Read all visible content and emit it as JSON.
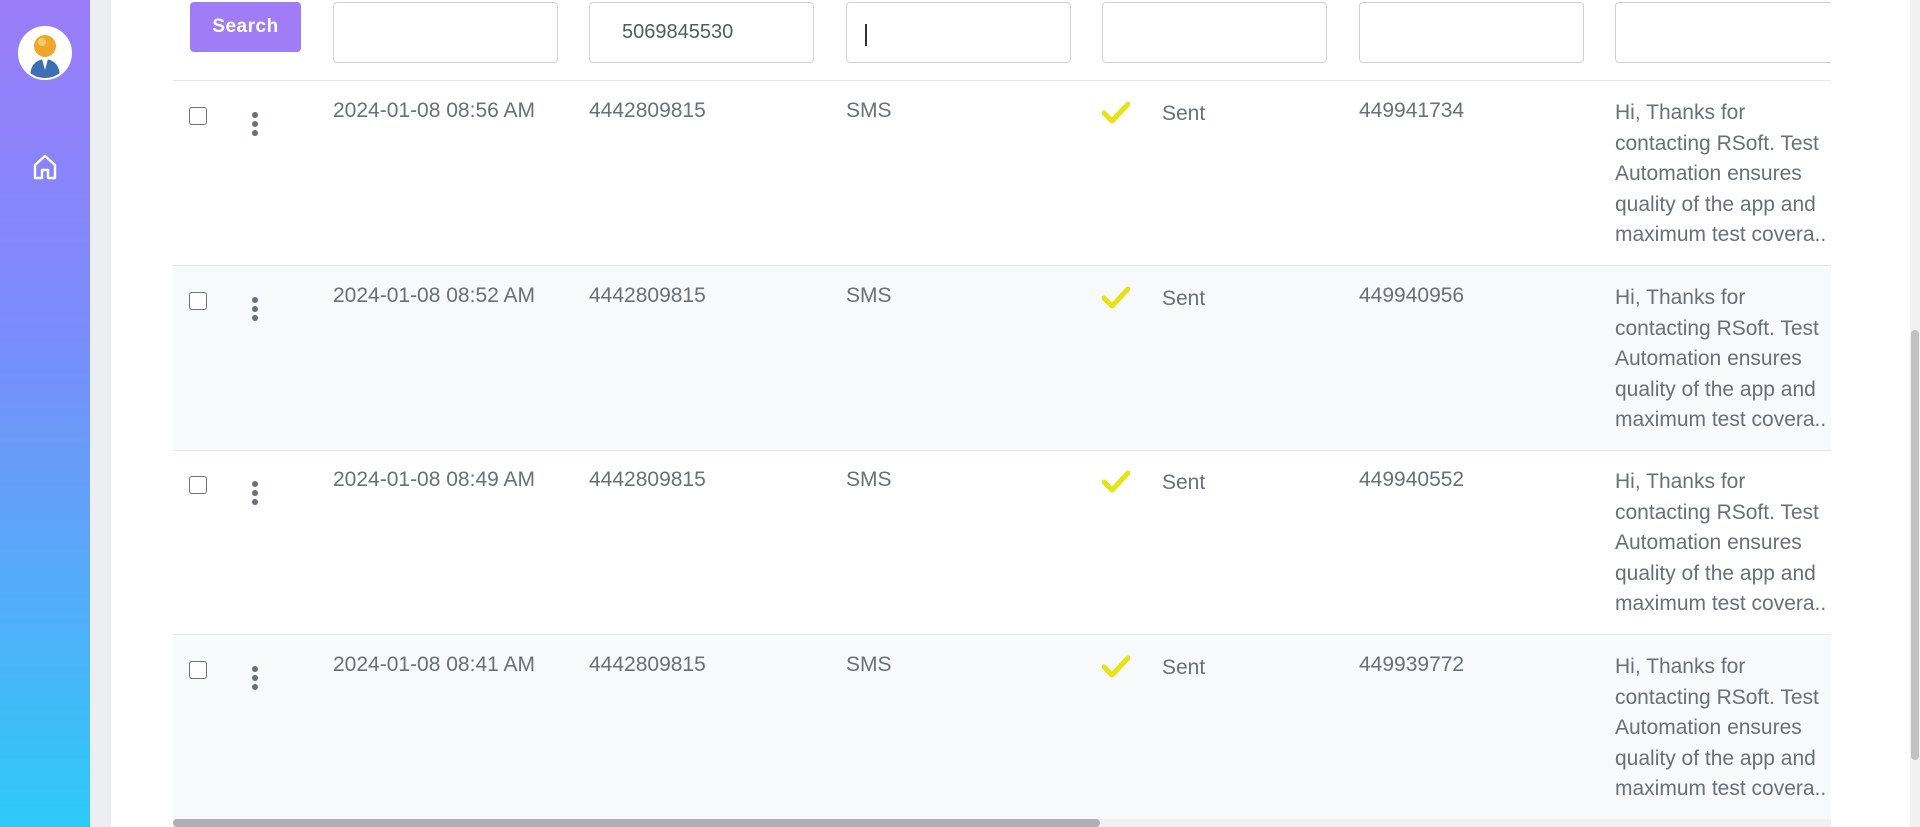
{
  "search": {
    "button_label": "Search"
  },
  "filters": [
    {
      "value": "",
      "placeholder": ""
    },
    {
      "value": "5069845530",
      "placeholder": ""
    },
    {
      "value": "",
      "placeholder": ""
    },
    {
      "value": "",
      "placeholder": ""
    },
    {
      "value": "",
      "placeholder": ""
    },
    {
      "value": "",
      "placeholder": ""
    }
  ],
  "rows": [
    {
      "date": "2024-01-08 08:56 AM",
      "from": "4442809815",
      "type": "SMS",
      "status": "Sent",
      "id": "449941734",
      "message": "Hi, Thanks for contacting RSoft. Test Automation ensures quality of the app and maximum test covera.."
    },
    {
      "date": "2024-01-08 08:52 AM",
      "from": "4442809815",
      "type": "SMS",
      "status": "Sent",
      "id": "449940956",
      "message": "Hi, Thanks for contacting RSoft. Test Automation ensures quality of the app and maximum test covera.."
    },
    {
      "date": "2024-01-08 08:49 AM",
      "from": "4442809815",
      "type": "SMS",
      "status": "Sent",
      "id": "449940552",
      "message": "Hi, Thanks for contacting RSoft. Test Automation ensures quality of the app and maximum test covera.."
    },
    {
      "date": "2024-01-08 08:41 AM",
      "from": "4442809815",
      "type": "SMS",
      "status": "Sent",
      "id": "449939772",
      "message": "Hi, Thanks for contacting RSoft. Test Automation ensures quality of the app and maximum test covera.."
    }
  ],
  "colors": {
    "accent": "#a07cf7",
    "check": "#e6e312",
    "text": "#6b6e7c"
  },
  "icons": {
    "avatar": "user-avatar-icon",
    "home": "home-icon",
    "row_menu": "kebab-menu-icon",
    "status": "checkmark-icon"
  }
}
